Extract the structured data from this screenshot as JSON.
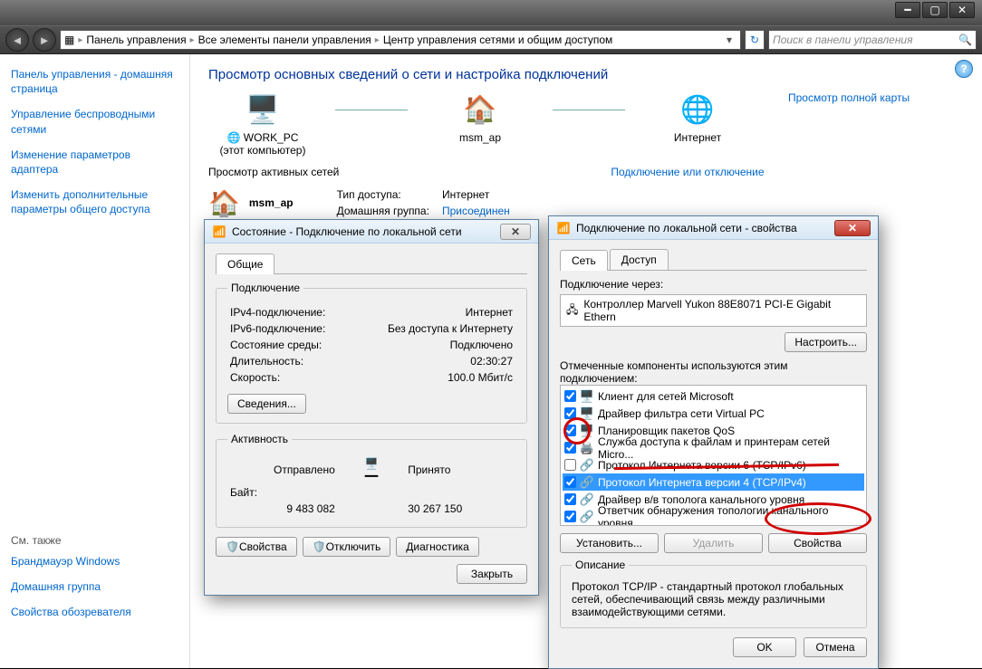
{
  "window": {
    "breadcrumbs": [
      "Панель управления",
      "Все элементы панели управления",
      "Центр управления сетями и общим доступом"
    ],
    "search_placeholder": "Поиск в панели управления"
  },
  "sidebar": {
    "links": [
      "Панель управления - домашняя страница",
      "Управление беспроводными сетями",
      "Изменение параметров адаптера",
      "Изменить дополнительные параметры общего доступа"
    ],
    "see_also_label": "См. также",
    "see_also": [
      "Брандмауэр Windows",
      "Домашняя группа",
      "Свойства обозревателя"
    ]
  },
  "main": {
    "heading": "Просмотр основных сведений о сети и настройка подключений",
    "full_map_link": "Просмотр полной карты",
    "nodes": {
      "pc": "WORK_PC",
      "pc_sub": "(этот компьютер)",
      "router": "msm_ap",
      "internet": "Интернет"
    },
    "active_nets_label": "Просмотр активных сетей",
    "connect_disconnect": "Подключение или отключение",
    "network_name": "msm_ap",
    "access_type_label": "Тип доступа:",
    "access_type_value": "Интернет",
    "homegroup_label": "Домашняя группа:",
    "homegroup_value": "Присоединен"
  },
  "status_dialog": {
    "title": "Состояние - Подключение по локальной сети",
    "tab_general": "Общие",
    "conn_legend": "Подключение",
    "rows": {
      "ipv4_label": "IPv4-подключение:",
      "ipv4_value": "Интернет",
      "ipv6_label": "IPv6-подключение:",
      "ipv6_value": "Без доступа к Интернету",
      "media_label": "Состояние среды:",
      "media_value": "Подключено",
      "duration_label": "Длительность:",
      "duration_value": "02:30:27",
      "speed_label": "Скорость:",
      "speed_value": "100.0 Мбит/с"
    },
    "details_btn": "Сведения...",
    "activity_legend": "Активность",
    "sent_label": "Отправлено",
    "recv_label": "Принято",
    "bytes_label": "Байт:",
    "bytes_sent": "9 483 082",
    "bytes_recv": "30 267 150",
    "btn_properties": "Свойства",
    "btn_disable": "Отключить",
    "btn_diagnose": "Диагностика",
    "btn_close": "Закрыть"
  },
  "props_dialog": {
    "title": "Подключение по локальной сети - свойства",
    "tab_network": "Сеть",
    "tab_access": "Доступ",
    "connect_using_label": "Подключение через:",
    "adapter": "Контроллер Marvell Yukon 88E8071 PCI-E Gigabit Ethern",
    "btn_configure": "Настроить...",
    "components_label": "Отмеченные компоненты используются этим подключением:",
    "components": [
      {
        "checked": true,
        "icon": "client-icon",
        "label": "Клиент для сетей Microsoft"
      },
      {
        "checked": true,
        "icon": "driver-icon",
        "label": "Драйвер фильтра сети Virtual PC"
      },
      {
        "checked": true,
        "icon": "qos-icon",
        "label": "Планировщик пакетов QoS"
      },
      {
        "checked": true,
        "icon": "share-icon",
        "label": "Служба доступа к файлам и принтерам сетей Micro..."
      },
      {
        "checked": false,
        "icon": "protocol-icon",
        "label": "Протокол Интернета версии 6 (TCP/IPv6)"
      },
      {
        "checked": true,
        "icon": "protocol-icon",
        "label": "Протокол Интернета версии 4 (TCP/IPv4)",
        "selected": true
      },
      {
        "checked": true,
        "icon": "protocol-icon",
        "label": "Драйвер в/в тополога канального уровня"
      },
      {
        "checked": true,
        "icon": "protocol-icon",
        "label": "Ответчик обнаружения топологии канального уровня"
      }
    ],
    "btn_install": "Установить...",
    "btn_uninstall": "Удалить",
    "btn_properties": "Свойства",
    "desc_legend": "Описание",
    "description": "Протокол TCP/IP - стандартный протокол глобальных сетей, обеспечивающий связь между различными взаимодействующими сетями.",
    "btn_ok": "OK",
    "btn_cancel": "Отмена"
  }
}
